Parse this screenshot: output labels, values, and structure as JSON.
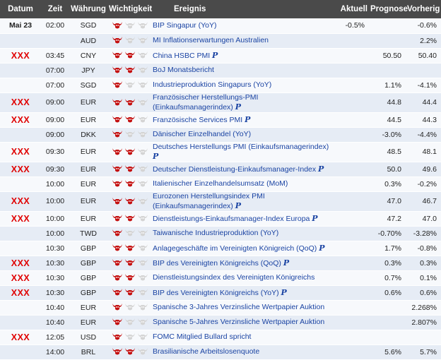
{
  "headers": {
    "date": "Datum",
    "time": "Zeit",
    "currency": "Währung",
    "importance": "Wichtigkeit",
    "event": "Ereignis",
    "actual": "Aktuell",
    "forecast": "Prognose",
    "previous": "Vorherig"
  },
  "colors": {
    "header_bg": "#4a4a4a",
    "row_alt": "#e6ecf5",
    "row": "#f7f9fc",
    "marker": "#e00000",
    "link": "#1b44a3",
    "bull_active": "#c41010",
    "bull_inactive": "#d4d4d4"
  },
  "pm_marker": "P",
  "rows": [
    {
      "date": "Mai 23",
      "flag": "",
      "time": "02:00",
      "currency": "SGD",
      "importance": 1,
      "event": "BIP Singapur (YoY)",
      "pm": false,
      "actual": "-0.5%",
      "forecast": "",
      "previous": "-0.6%"
    },
    {
      "date": "",
      "flag": "",
      "time": "",
      "currency": "AUD",
      "importance": 1,
      "event": "MI Inflationserwartungen Australien",
      "pm": false,
      "actual": "",
      "forecast": "",
      "previous": "2.2%"
    },
    {
      "date": "",
      "flag": "XXX",
      "time": "03:45",
      "currency": "CNY",
      "importance": 2,
      "event": "China HSBC PMI",
      "pm": true,
      "actual": "",
      "forecast": "50.50",
      "previous": "50.40"
    },
    {
      "date": "",
      "flag": "",
      "time": "07:00",
      "currency": "JPY",
      "importance": 2,
      "event": "BoJ Monatsbericht",
      "pm": false,
      "actual": "",
      "forecast": "",
      "previous": ""
    },
    {
      "date": "",
      "flag": "",
      "time": "07:00",
      "currency": "SGD",
      "importance": 1,
      "event": "Industrieproduktion Singapurs (YoY)",
      "pm": false,
      "actual": "",
      "forecast": "1.1%",
      "previous": "-4.1%"
    },
    {
      "date": "",
      "flag": "XXX",
      "time": "09:00",
      "currency": "EUR",
      "importance": 2,
      "event_lines": [
        "Französischer Herstellungs-PMI",
        "(Einkaufsmanagerindex)"
      ],
      "pm": true,
      "actual": "",
      "forecast": "44.8",
      "previous": "44.4"
    },
    {
      "date": "",
      "flag": "XXX",
      "time": "09:00",
      "currency": "EUR",
      "importance": 2,
      "event": "Französische Services PMI",
      "pm": true,
      "actual": "",
      "forecast": "44.5",
      "previous": "44.3"
    },
    {
      "date": "",
      "flag": "",
      "time": "09:00",
      "currency": "DKK",
      "importance": 1,
      "event": "Dänischer Einzelhandel (YoY)",
      "pm": false,
      "actual": "",
      "forecast": "-3.0%",
      "previous": "-4.4%"
    },
    {
      "date": "",
      "flag": "XXX",
      "time": "09:30",
      "currency": "EUR",
      "importance": 2,
      "event_lines": [
        "Deutsches Herstellungs PMI (Einkaufsmanagerindex)",
        ""
      ],
      "pm": true,
      "actual": "",
      "forecast": "48.5",
      "previous": "48.1"
    },
    {
      "date": "",
      "flag": "XXX",
      "time": "09:30",
      "currency": "EUR",
      "importance": 2,
      "event": "Deutscher Dienstleistung-Einkaufsmanager-Index",
      "pm": true,
      "actual": "",
      "forecast": "50.0",
      "previous": "49.6"
    },
    {
      "date": "",
      "flag": "",
      "time": "10:00",
      "currency": "EUR",
      "importance": 2,
      "event": "Italienischer Einzelhandelsumsatz (MoM)",
      "pm": false,
      "actual": "",
      "forecast": "0.3%",
      "previous": "-0.2%"
    },
    {
      "date": "",
      "flag": "XXX",
      "time": "10:00",
      "currency": "EUR",
      "importance": 2,
      "event_lines": [
        "Eurozonen Herstellungsindex PMI",
        "(Einkaufsmanagerindex)"
      ],
      "pm": true,
      "actual": "",
      "forecast": "47.0",
      "previous": "46.7"
    },
    {
      "date": "",
      "flag": "XXX",
      "time": "10:00",
      "currency": "EUR",
      "importance": 2,
      "event": "Dienstleistungs-Einkaufsmanager-Index Europa",
      "pm": true,
      "actual": "",
      "forecast": "47.2",
      "previous": "47.0"
    },
    {
      "date": "",
      "flag": "",
      "time": "10:00",
      "currency": "TWD",
      "importance": 1,
      "event": "Taiwanische Industrieproduktion (YoY)",
      "pm": false,
      "actual": "",
      "forecast": "-0.70%",
      "previous": "-3.28%"
    },
    {
      "date": "",
      "flag": "",
      "time": "10:30",
      "currency": "GBP",
      "importance": 2,
      "event": "Anlagegeschäfte im Vereinigten Königreich (QoQ)",
      "pm": true,
      "actual": "",
      "forecast": "1.7%",
      "previous": "-0.8%"
    },
    {
      "date": "",
      "flag": "XXX",
      "time": "10:30",
      "currency": "GBP",
      "importance": 2,
      "event": "BIP des Vereinigten Königreichs (QoQ)",
      "pm": true,
      "actual": "",
      "forecast": "0.3%",
      "previous": "0.3%"
    },
    {
      "date": "",
      "flag": "XXX",
      "time": "10:30",
      "currency": "GBP",
      "importance": 2,
      "event": "Dienstleistungsindex des Vereinigten Königreichs",
      "pm": false,
      "actual": "",
      "forecast": "0.7%",
      "previous": "0.1%"
    },
    {
      "date": "",
      "flag": "XXX",
      "time": "10:30",
      "currency": "GBP",
      "importance": 2,
      "event": "BIP des Vereinigten Königreichs (YoY)",
      "pm": true,
      "actual": "",
      "forecast": "0.6%",
      "previous": "0.6%"
    },
    {
      "date": "",
      "flag": "",
      "time": "10:40",
      "currency": "EUR",
      "importance": 1,
      "event": "Spanische 3-Jahres Verzinsliche Wertpapier Auktion",
      "pm": false,
      "actual": "",
      "forecast": "",
      "previous": "2.268%"
    },
    {
      "date": "",
      "flag": "",
      "time": "10:40",
      "currency": "EUR",
      "importance": 1,
      "event": "Spanische 5-Jahres Verzinsliche Wertpapier Auktion",
      "pm": false,
      "actual": "",
      "forecast": "",
      "previous": "2.807%"
    },
    {
      "date": "",
      "flag": "XXX",
      "time": "12:05",
      "currency": "USD",
      "importance": 1,
      "event": "FOMC Mitglied Bullard spricht",
      "pm": false,
      "actual": "",
      "forecast": "",
      "previous": ""
    },
    {
      "date": "",
      "flag": "",
      "time": "14:00",
      "currency": "BRL",
      "importance": 2,
      "event": "Brasilianische Arbeitslosenquote",
      "pm": false,
      "actual": "",
      "forecast": "5.6%",
      "previous": "5.7%"
    }
  ]
}
